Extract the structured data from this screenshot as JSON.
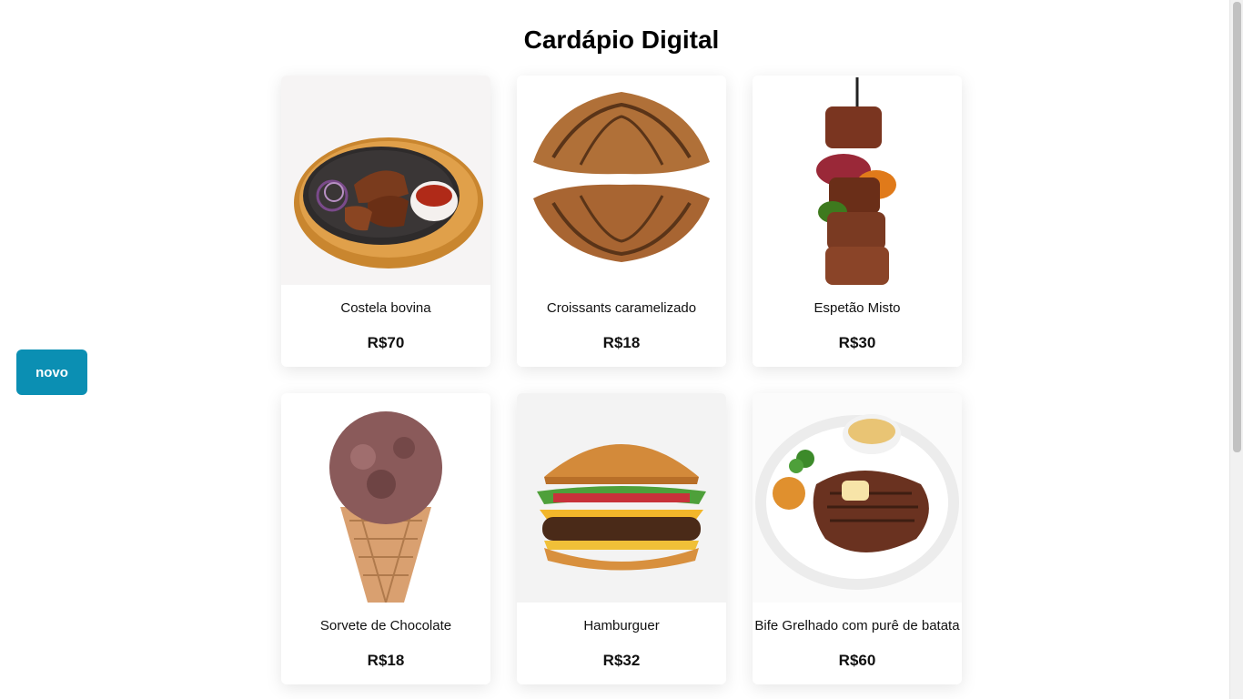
{
  "page": {
    "title": "Cardápio Digital"
  },
  "actions": {
    "new_label": "novo"
  },
  "menu_items": [
    {
      "name": "Costela bovina",
      "price": "R$70",
      "image_icon": "ribs-platter-icon"
    },
    {
      "name": "Croissants caramelizado",
      "price": "R$18",
      "image_icon": "croissant-icon"
    },
    {
      "name": "Espetão Misto",
      "price": "R$30",
      "image_icon": "skewer-icon"
    },
    {
      "name": "Sorvete de Chocolate",
      "price": "R$18",
      "image_icon": "ice-cream-cone-icon"
    },
    {
      "name": "Hamburguer",
      "price": "R$32",
      "image_icon": "hamburger-icon"
    },
    {
      "name": "Bife Grelhado com purê de batata",
      "price": "R$60",
      "image_icon": "steak-plate-icon"
    }
  ],
  "colors": {
    "accent": "#0b8fb3",
    "background": "#ffffff",
    "card_shadow": "rgba(0,0,0,0.10)"
  }
}
